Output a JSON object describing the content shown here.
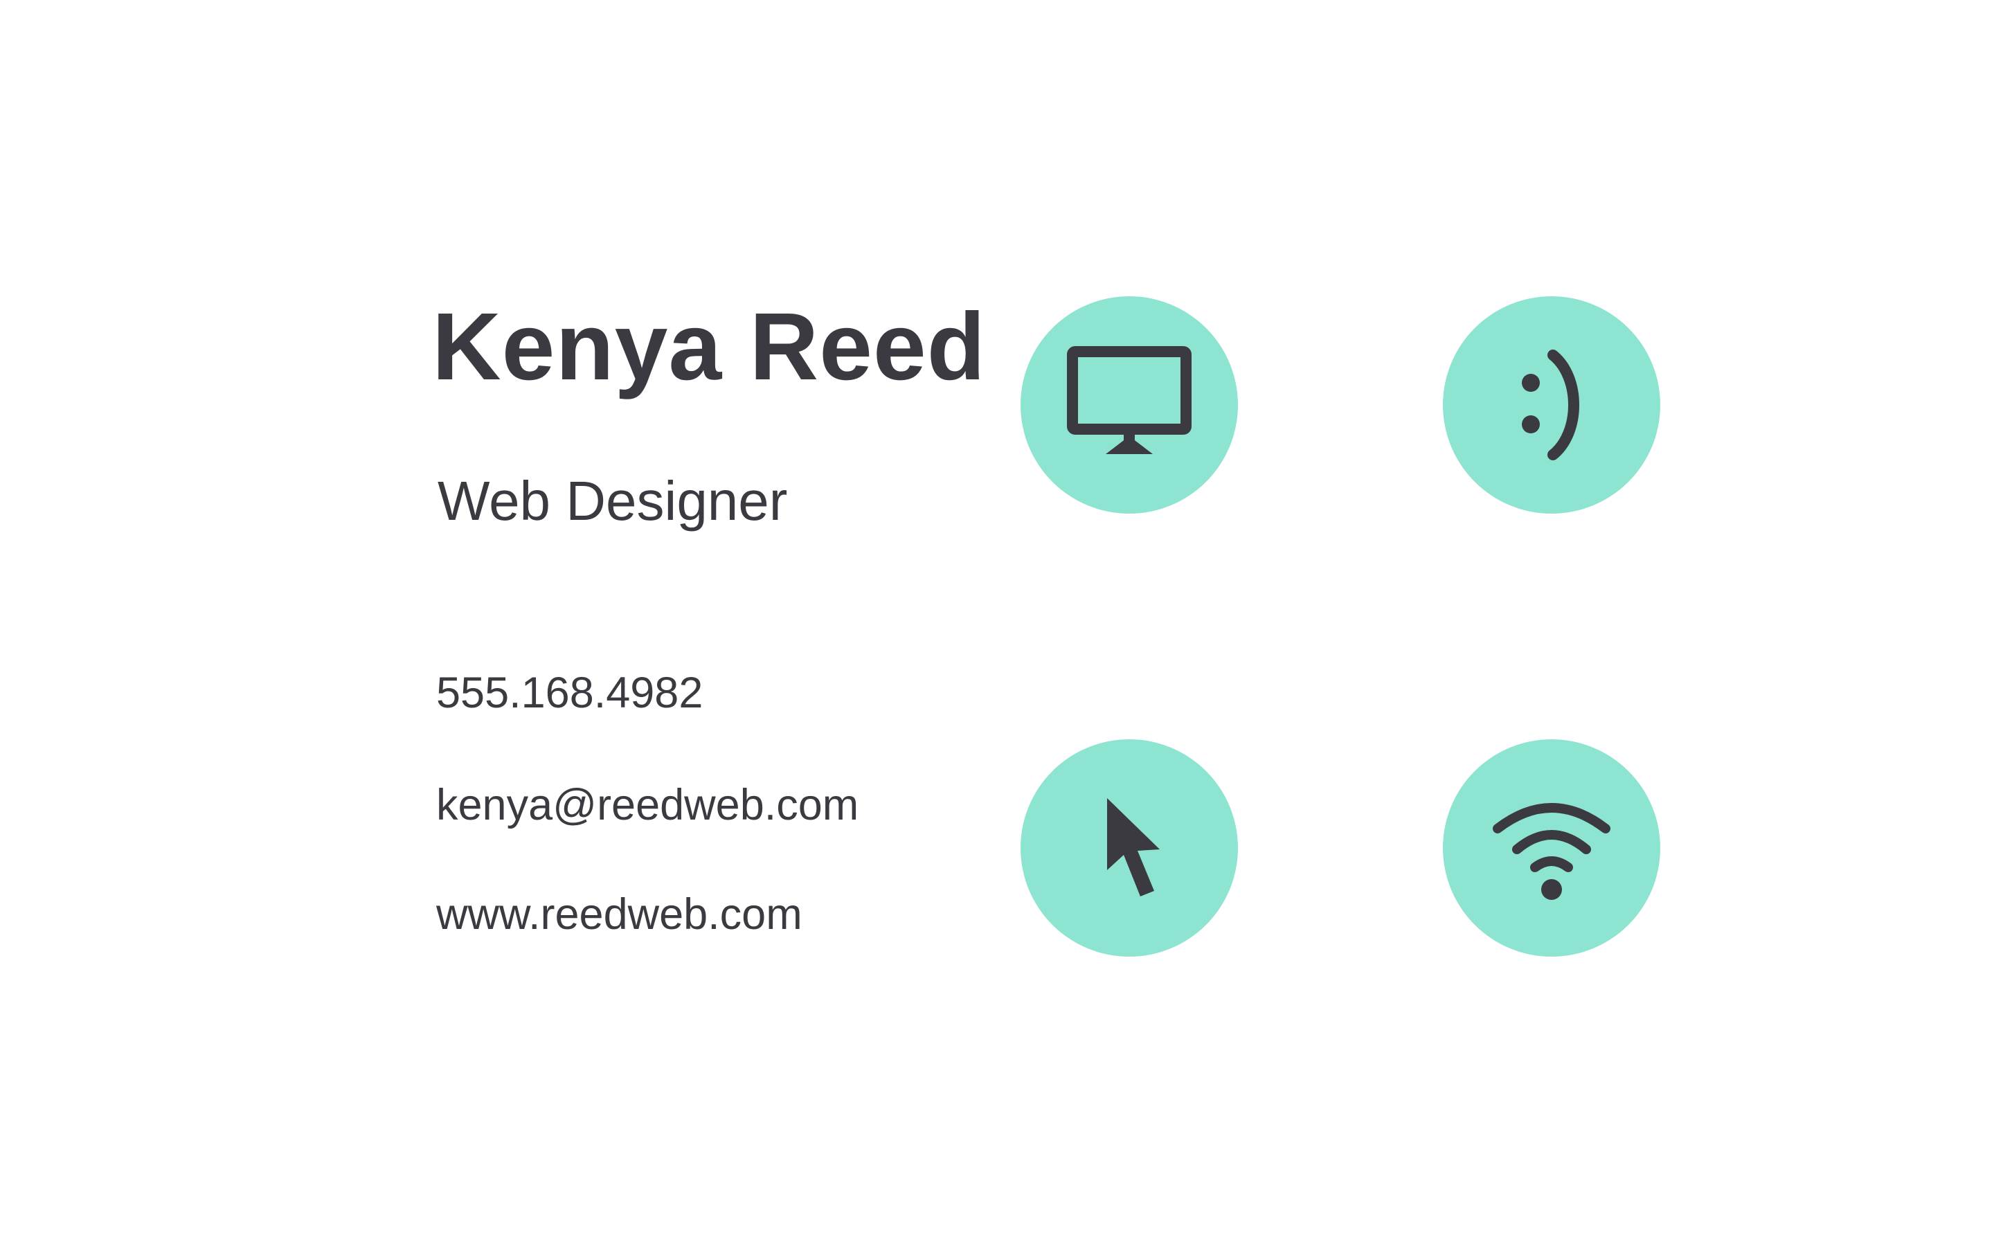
{
  "card": {
    "name": "Kenya Reed",
    "title": "Web Designer",
    "phone": "555.168.4982",
    "email": "kenya@reedweb.com",
    "website": "www.reedweb.com"
  },
  "icons": [
    {
      "name": "monitor-icon"
    },
    {
      "name": "smiley-icon",
      "text": ":)"
    },
    {
      "name": "cursor-arrow-icon"
    },
    {
      "name": "wifi-icon"
    }
  ],
  "colors": {
    "background": "#ffffff",
    "text": "#3a3a40",
    "accent": "#8de4d1"
  }
}
